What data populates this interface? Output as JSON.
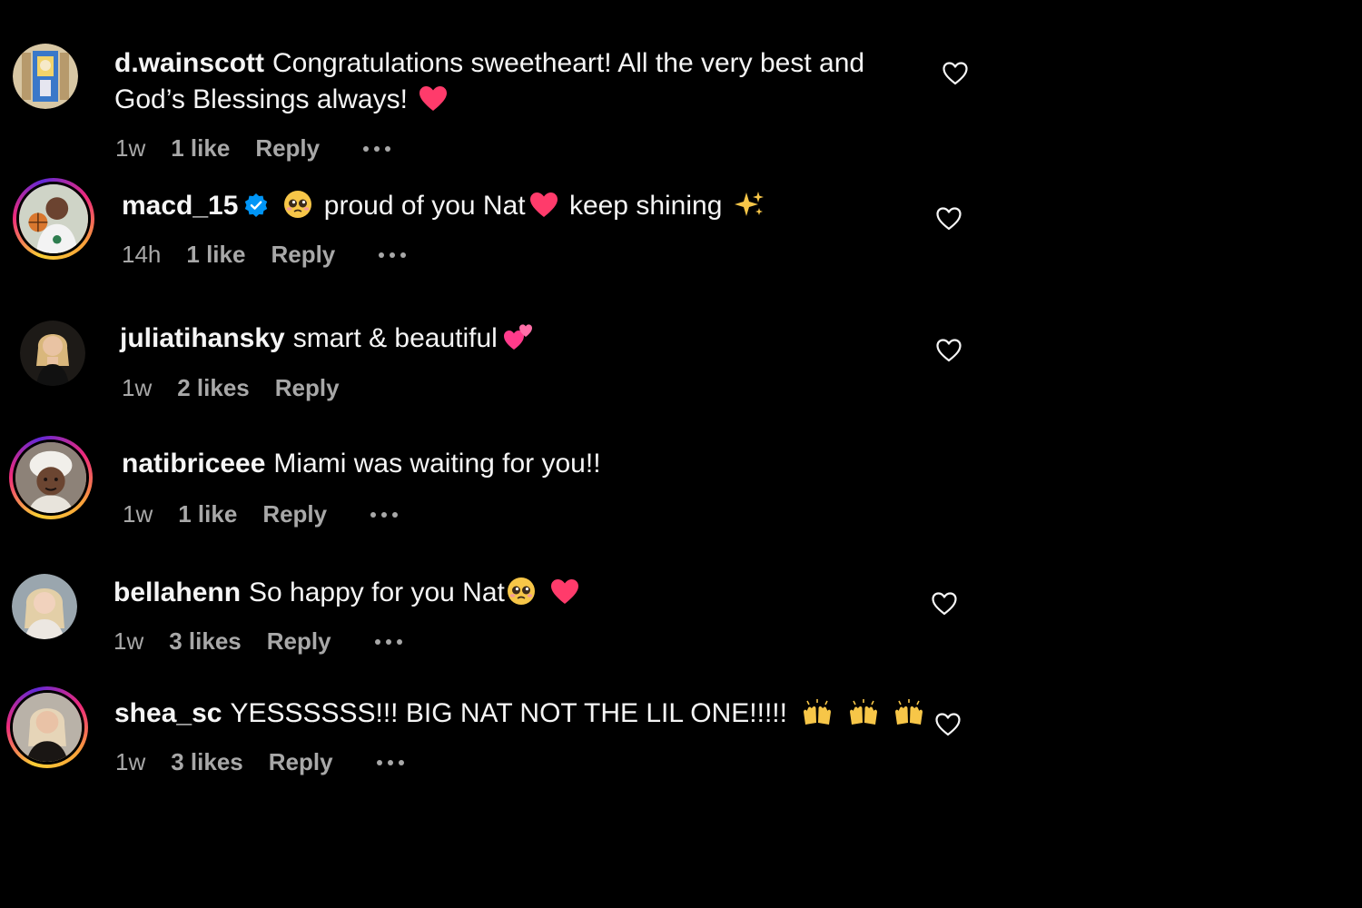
{
  "comments": [
    {
      "username": "d.wainscott",
      "text": "Congratulations sweetheart! All the very best and God’s Blessings always!",
      "time": "1w",
      "likes": "1 like",
      "reply": "Reply"
    },
    {
      "username": "macd_15",
      "verified": true,
      "text_a": "proud of you Nat",
      "text_b": "keep shining",
      "time": "14h",
      "likes": "1 like",
      "reply": "Reply"
    },
    {
      "username": "juliatihansky",
      "text": "smart & beautiful",
      "time": "1w",
      "likes": "2 likes",
      "reply": "Reply"
    },
    {
      "username": "natibriceee",
      "text": "Miami was waiting for you!!",
      "time": "1w",
      "likes": "1 like",
      "reply": "Reply"
    },
    {
      "username": "bellahenn",
      "text": "So happy for you Nat",
      "time": "1w",
      "likes": "3 likes",
      "reply": "Reply"
    },
    {
      "username": "shea_sc",
      "text": "YESSSSSS!!! BIG NAT NOT THE LIL ONE!!!!!",
      "time": "1w",
      "likes": "3 likes",
      "reply": "Reply"
    }
  ],
  "icons": {
    "like": "heart-outline-icon",
    "more": "ellipsis-icon",
    "verified": "verified-badge-icon"
  },
  "colors": {
    "background": "#000000",
    "text": "#f5f5f5",
    "meta": "#a8a8a8",
    "verified": "#0095f6",
    "heart_emoji": "#ff3b6b"
  }
}
